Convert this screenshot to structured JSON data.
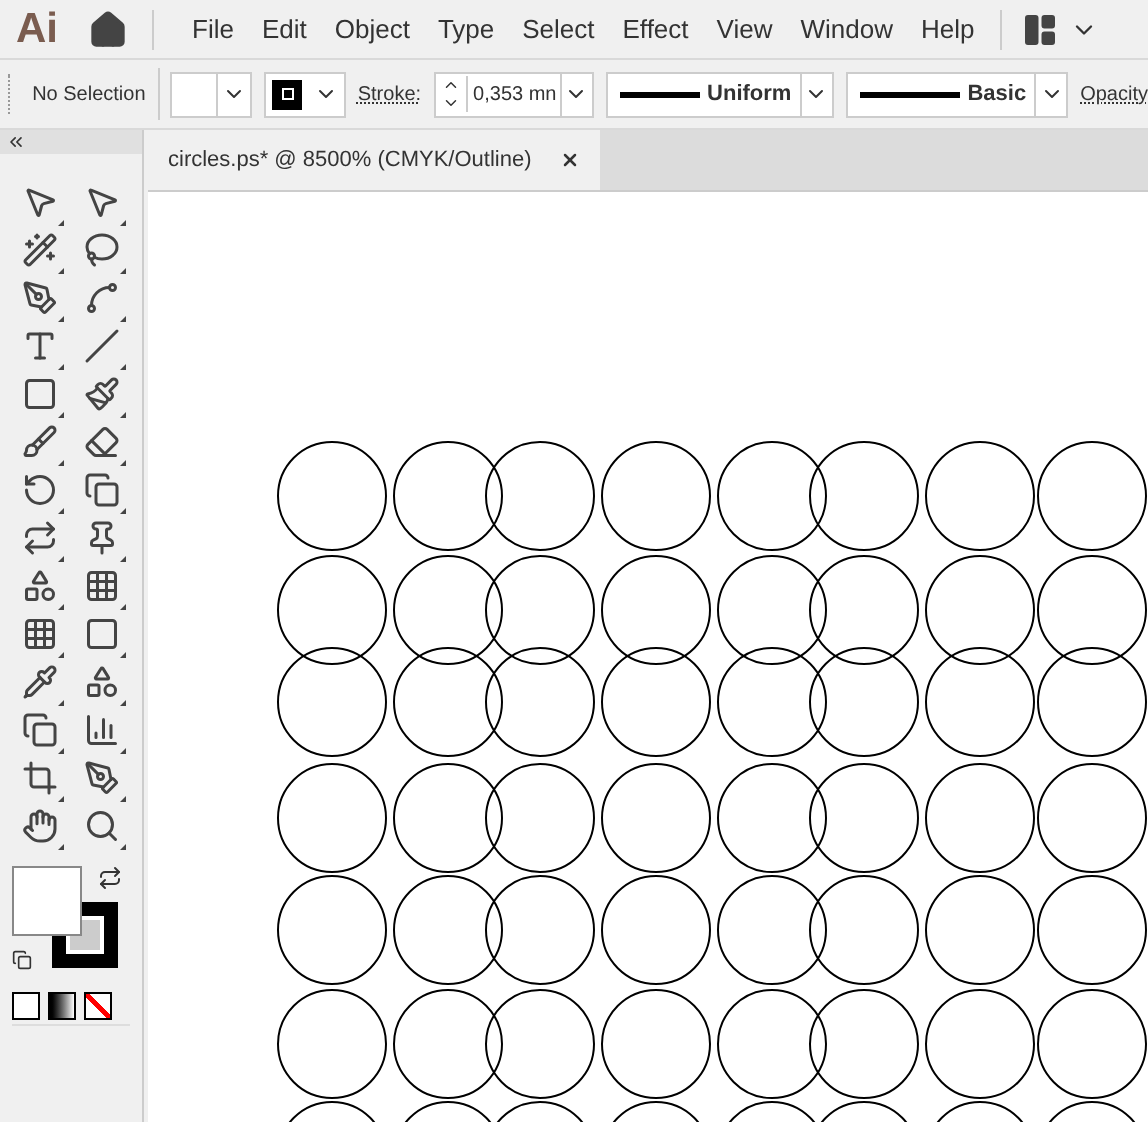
{
  "app_logo": "Ai",
  "menu": [
    "File",
    "Edit",
    "Object",
    "Type",
    "Select",
    "Effect",
    "View",
    "Window",
    "Help"
  ],
  "control_bar": {
    "selection": "No Selection",
    "stroke_label": "Stroke:",
    "stroke_value": "0,353 mn",
    "profile": "Uniform",
    "brush": "Basic",
    "opacity_label": "Opacity"
  },
  "document_tab": {
    "title": "circles.ps* @ 8500% (CMYK/Outline)",
    "selected": true
  }
}
